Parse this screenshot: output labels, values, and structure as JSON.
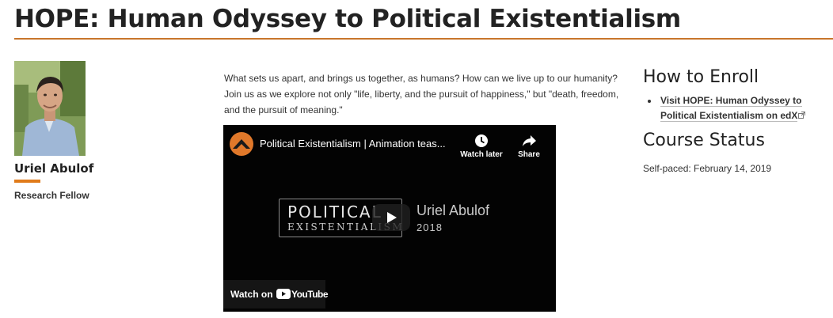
{
  "page": {
    "title": "HOPE: Human Odyssey to Political Existentialism"
  },
  "person": {
    "name": "Uriel Abulof",
    "role": "Research Fellow"
  },
  "course": {
    "description": "What sets us apart, and brings us together, as humans? How can we live up to our humanity? Join us as we explore not only \"life, liberty, and the pursuit of happiness,\" but \"death, freedom, and the pursuit of meaning.\""
  },
  "video": {
    "title": "Political Existentialism | Animation teas...",
    "watch_later_label": "Watch later",
    "share_label": "Share",
    "thumb_title_line1": "POLITICAL",
    "thumb_title_line2": "EXISTENTIALISM",
    "thumb_author": "Uriel Abulof",
    "thumb_year": "2018",
    "watch_on_label": "Watch on",
    "youtube_label": "YouTube"
  },
  "sidebar": {
    "enroll_heading": "How to Enroll",
    "enroll_links": [
      {
        "label": "Visit HOPE: Human Odyssey to Political Existentialism on edX"
      }
    ],
    "status_heading": "Course Status",
    "status_text": "Self-paced: February 14, 2019"
  },
  "colors": {
    "accent": "#c8762b",
    "name_underline": "#e07b1a",
    "video_bg": "#030303"
  }
}
